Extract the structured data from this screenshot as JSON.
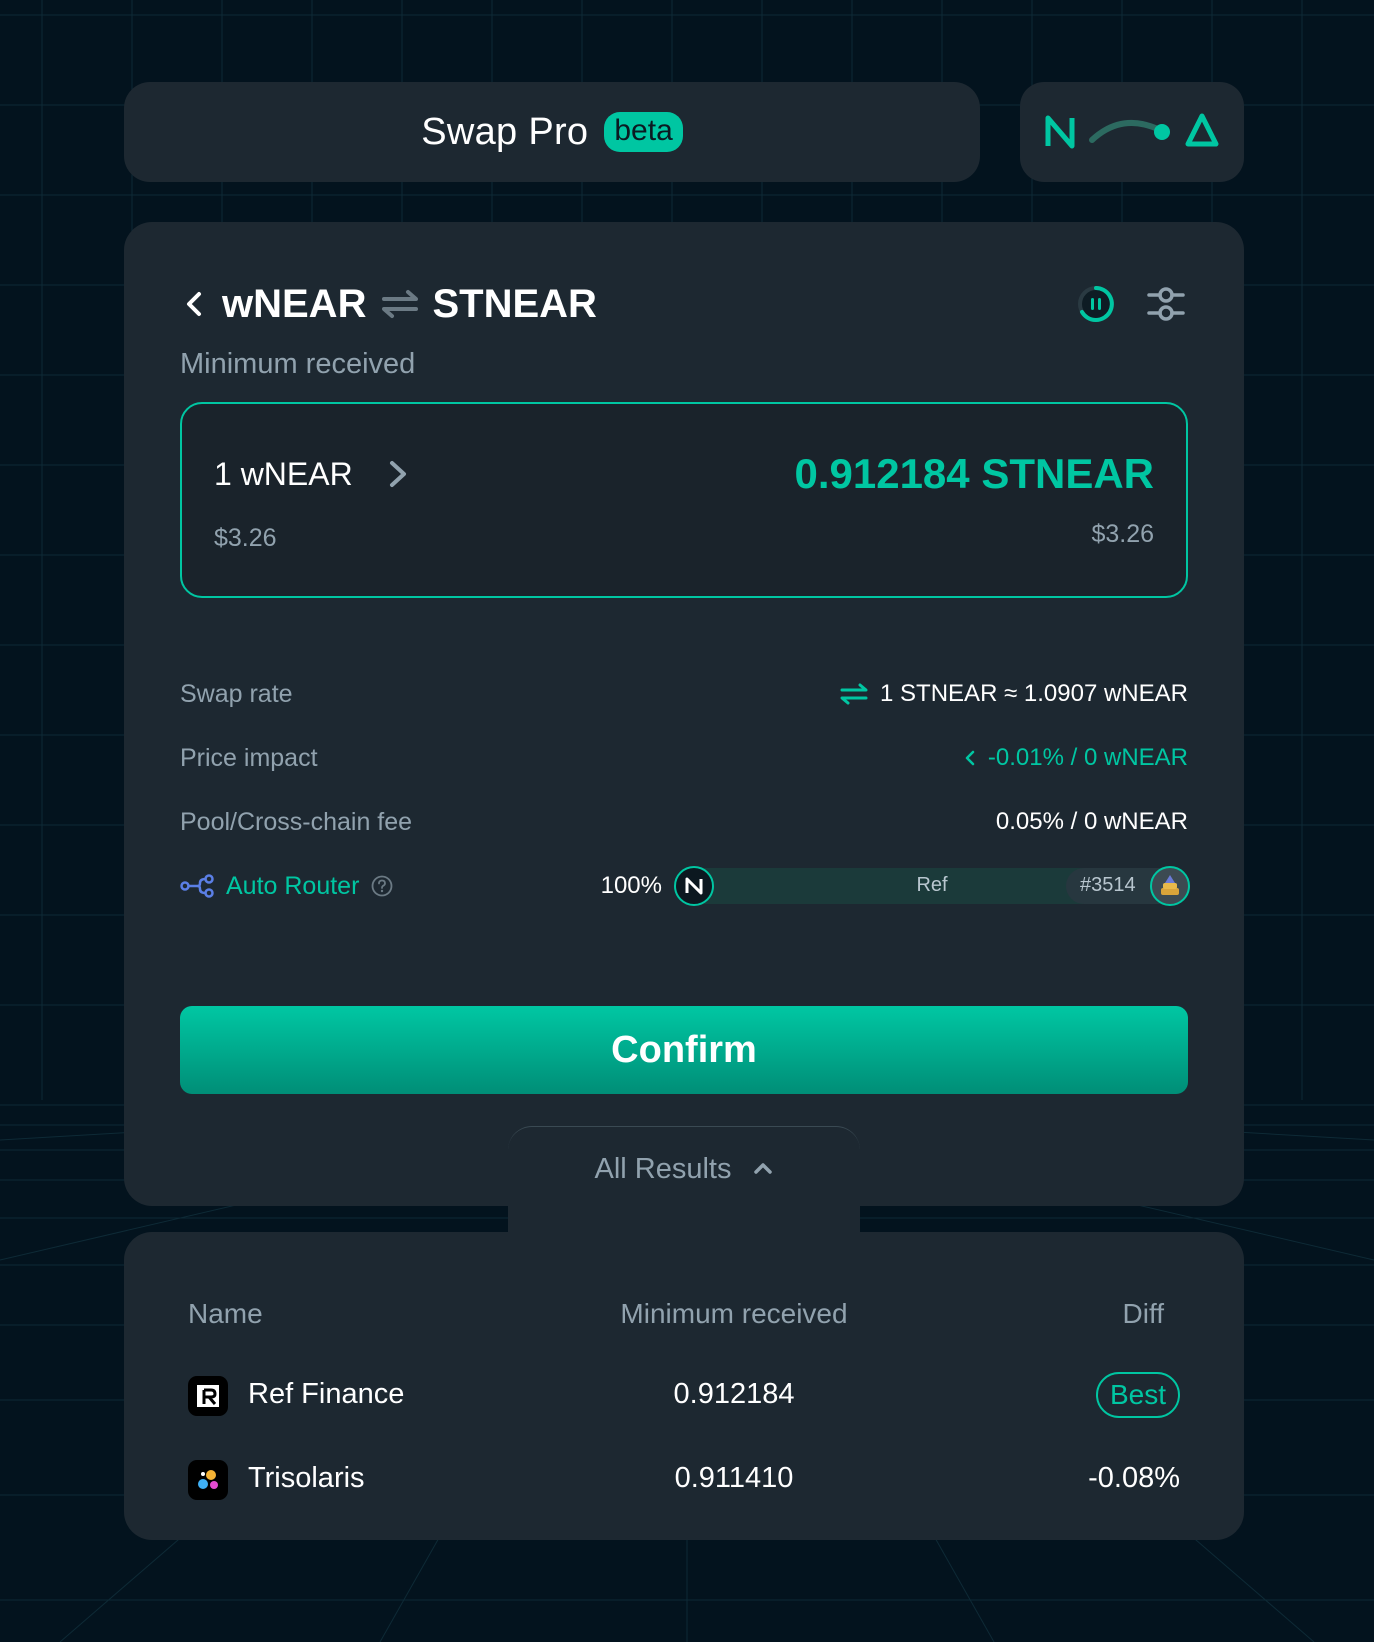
{
  "header": {
    "title": "Swap Pro",
    "beta_label": "beta",
    "network_icons": [
      "near-logo-icon",
      "bridge-toggle-icon",
      "aurora-logo-icon"
    ]
  },
  "pair": {
    "from_token": "wNEAR",
    "to_token": "STNEAR",
    "icons": [
      "back-chevron-icon",
      "swap-direction-icon",
      "refresh-timer-icon",
      "settings-sliders-icon"
    ]
  },
  "minimum_received": {
    "label": "Minimum received",
    "from_amount": "1 wNEAR",
    "from_usd": "$3.26",
    "to_amount": "0.912184 STNEAR",
    "to_usd": "$3.26"
  },
  "details": {
    "swap_rate_label": "Swap rate",
    "swap_rate_value": "1 STNEAR ≈ 1.0907 wNEAR",
    "price_impact_label": "Price impact",
    "price_impact_value": "-0.01% / 0 wNEAR",
    "fee_label": "Pool/Cross-chain fee",
    "fee_value": "0.05% / 0 wNEAR"
  },
  "router": {
    "label": "Auto Router",
    "percent": "100%",
    "pool_name": "Ref",
    "pool_id": "#3514"
  },
  "confirm_label": "Confirm",
  "all_results_label": "All Results",
  "results": {
    "headers": {
      "name": "Name",
      "min_received": "Minimum received",
      "diff": "Diff"
    },
    "rows": [
      {
        "name": "Ref Finance",
        "min_received": "0.912184",
        "diff": "Best"
      },
      {
        "name": "Trisolaris",
        "min_received": "0.911410",
        "diff": "-0.08%"
      }
    ]
  },
  "colors": {
    "accent": "#00c6a2",
    "card": "#1d2831",
    "background": "#03131e",
    "muted_text": "#91a2ae"
  }
}
